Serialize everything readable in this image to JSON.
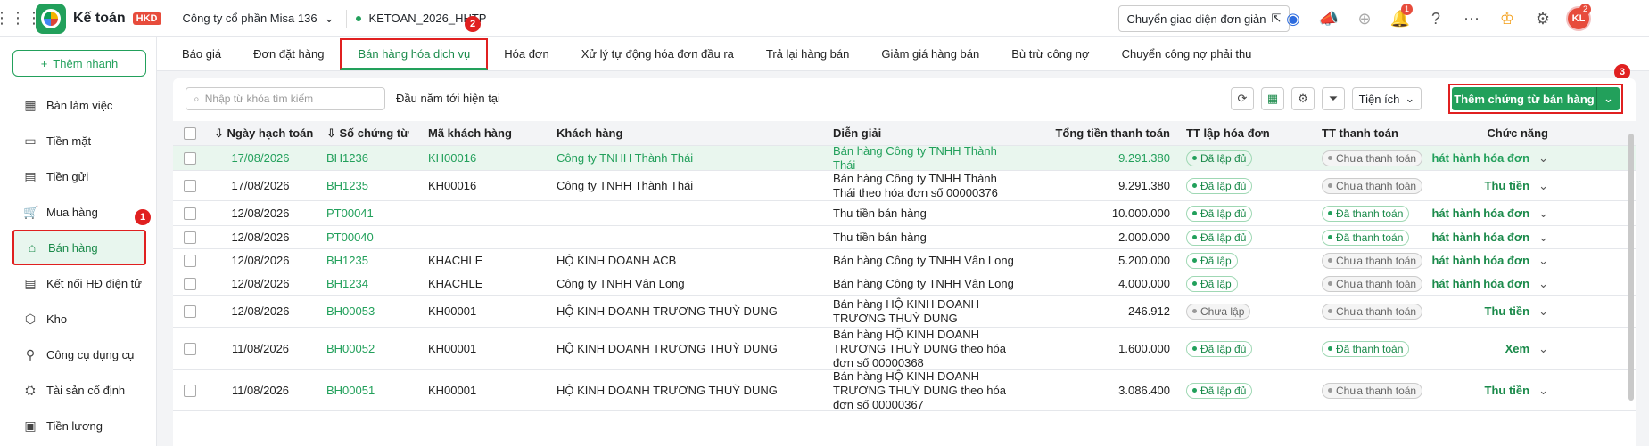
{
  "header": {
    "app_title": "Kế toán",
    "app_badge": "HKD",
    "company": "Công ty cổ phần Misa 136",
    "database": "KETOAN_2026_HHTP",
    "switch_mode": "Chuyển giao diện đơn giản",
    "notification_count": "1",
    "avatar_initials": "KL",
    "avatar_badge": "2"
  },
  "sidebar": {
    "add_quick": "Thêm nhanh",
    "items": [
      {
        "label": "Bàn làm việc",
        "icon": "dashboard-icon"
      },
      {
        "label": "Tiền mặt",
        "icon": "cash-icon"
      },
      {
        "label": "Tiền gửi",
        "icon": "bank-icon"
      },
      {
        "label": "Mua hàng",
        "icon": "cart-icon"
      },
      {
        "label": "Bán hàng",
        "icon": "tag-icon"
      },
      {
        "label": "Kết nối HĐ điện tử",
        "icon": "invoice-icon"
      },
      {
        "label": "Kho",
        "icon": "box-icon"
      },
      {
        "label": "Công cụ dụng cụ",
        "icon": "tools-icon"
      },
      {
        "label": "Tài sản cố định",
        "icon": "asset-icon"
      },
      {
        "label": "Tiền lương",
        "icon": "salary-icon"
      }
    ]
  },
  "tabs": [
    "Báo giá",
    "Đơn đặt hàng",
    "Bán hàng hóa dịch vụ",
    "Hóa đơn",
    "Xử lý tự động hóa đơn đầu ra",
    "Trả lại hàng bán",
    "Giảm giá hàng bán",
    "Bù trừ công nợ",
    "Chuyển công nợ phải thu"
  ],
  "toolbar": {
    "search_placeholder": "Nhập từ khóa tìm kiếm",
    "period": "Đầu năm tới hiện tại",
    "utility": "Tiện ích",
    "add_doc": "Thêm chứng từ bán hàng"
  },
  "annotations": [
    "1",
    "2",
    "3"
  ],
  "table": {
    "headers": {
      "date": "Ngày hạch toán",
      "no": "Số chứng từ",
      "customer_code": "Mã khách hàng",
      "customer": "Khách hàng",
      "description": "Diễn giải",
      "total": "Tổng tiền thanh toán",
      "invoice_status": "TT lập hóa đơn",
      "payment_status": "TT thanh toán",
      "action": "Chức năng"
    },
    "rows": [
      {
        "date": "17/08/2026",
        "no": "BH1236",
        "code": "KH00016",
        "customer": "Công ty TNHH Thành Thái",
        "desc": "Bán hàng Công ty TNHH Thành Thái",
        "total": "9.291.380",
        "inv": "Đã lập đủ",
        "pay": "Chưa thanh toán",
        "action": "Phát hành hóa đơn"
      },
      {
        "date": "17/08/2026",
        "no": "BH1235",
        "code": "KH00016",
        "customer": "Công ty TNHH Thành Thái",
        "desc": "Bán hàng Công ty TNHH Thành Thái theo hóa đơn số 00000376",
        "total": "9.291.380",
        "inv": "Đã lập đủ",
        "pay": "Chưa thanh toán",
        "action": "Thu tiền"
      },
      {
        "date": "12/08/2026",
        "no": "PT00041",
        "code": "",
        "customer": "",
        "desc": "Thu tiền bán hàng",
        "total": "10.000.000",
        "inv": "Đã lập đủ",
        "pay": "Đã thanh toán",
        "action": "Phát hành hóa đơn"
      },
      {
        "date": "12/08/2026",
        "no": "PT00040",
        "code": "",
        "customer": "",
        "desc": "Thu tiền bán hàng",
        "total": "2.000.000",
        "inv": "Đã lập đủ",
        "pay": "Đã thanh toán",
        "action": "Phát hành hóa đơn"
      },
      {
        "date": "12/08/2026",
        "no": "BH1235",
        "code": "KHACHLE",
        "customer": "HỘ KINH DOANH ACB",
        "desc": "Bán hàng Công ty TNHH Vân Long",
        "total": "5.200.000",
        "inv": "Đã lập",
        "pay": "Chưa thanh toán",
        "action": "Phát hành hóa đơn"
      },
      {
        "date": "12/08/2026",
        "no": "BH1234",
        "code": "KHACHLE",
        "customer": "Công ty TNHH Vân Long",
        "desc": "Bán hàng Công ty TNHH Vân Long",
        "total": "4.000.000",
        "inv": "Đã lập",
        "pay": "Chưa thanh toán",
        "action": "Phát hành hóa đơn"
      },
      {
        "date": "12/08/2026",
        "no": "BH00053",
        "code": "KH00001",
        "customer": "HỘ KINH DOANH TRƯƠNG THUỲ DUNG",
        "desc": "Bán hàng HỘ KINH DOANH TRƯƠNG THUỲ DUNG",
        "total": "246.912",
        "inv": "Chưa lập",
        "pay": "Chưa thanh toán",
        "action": "Thu tiền"
      },
      {
        "date": "11/08/2026",
        "no": "BH00052",
        "code": "KH00001",
        "customer": "HỘ KINH DOANH TRƯƠNG THUỲ DUNG",
        "desc": "Bán hàng HỘ KINH DOANH TRƯƠNG THUỲ DUNG theo hóa đơn số 00000368",
        "total": "1.600.000",
        "inv": "Đã lập đủ",
        "pay": "Đã thanh toán",
        "action": "Xem"
      },
      {
        "date": "11/08/2026",
        "no": "BH00051",
        "code": "KH00001",
        "customer": "HỘ KINH DOANH TRƯƠNG THUỲ DUNG",
        "desc": "Bán hàng HỘ KINH DOANH TRƯƠNG THUỲ DUNG theo hóa đơn số 00000367",
        "total": "3.086.400",
        "inv": "Đã lập đủ",
        "pay": "Chưa thanh toán",
        "action": "Thu tiền"
      }
    ]
  },
  "colors": {
    "brand": "#22a05b",
    "highlight_border": "#e02020"
  }
}
